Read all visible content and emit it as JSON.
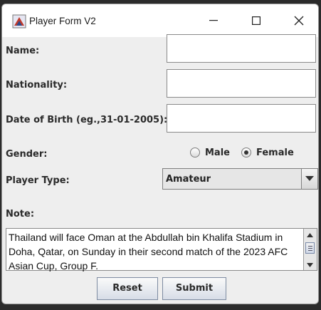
{
  "window": {
    "title": "Player Form V2"
  },
  "titlebar": {
    "icons": [
      "app-icon",
      "minimize-icon",
      "maximize-icon",
      "close-icon"
    ]
  },
  "form": {
    "name_label": "Name:",
    "nationality_label": "Nationality:",
    "dob_label": "Date of Birth (eg.,31-01-2005):",
    "name_value": "",
    "nationality_value": "",
    "dob_value": "",
    "gender_label": "Gender:",
    "gender_options": [
      "Male",
      "Female"
    ],
    "gender_selected": "Female",
    "player_type_label": "Player Type:",
    "player_type_value": "Amateur",
    "note_label": "Note:",
    "note_text": "Thailand will face Oman at the Abdullah bin Khalifa Stadium in Doha, Qatar, on Sunday in their second match of the 2023 AFC Asian Cup, Group F."
  },
  "buttons": {
    "reset": "Reset",
    "submit": "Submit"
  }
}
